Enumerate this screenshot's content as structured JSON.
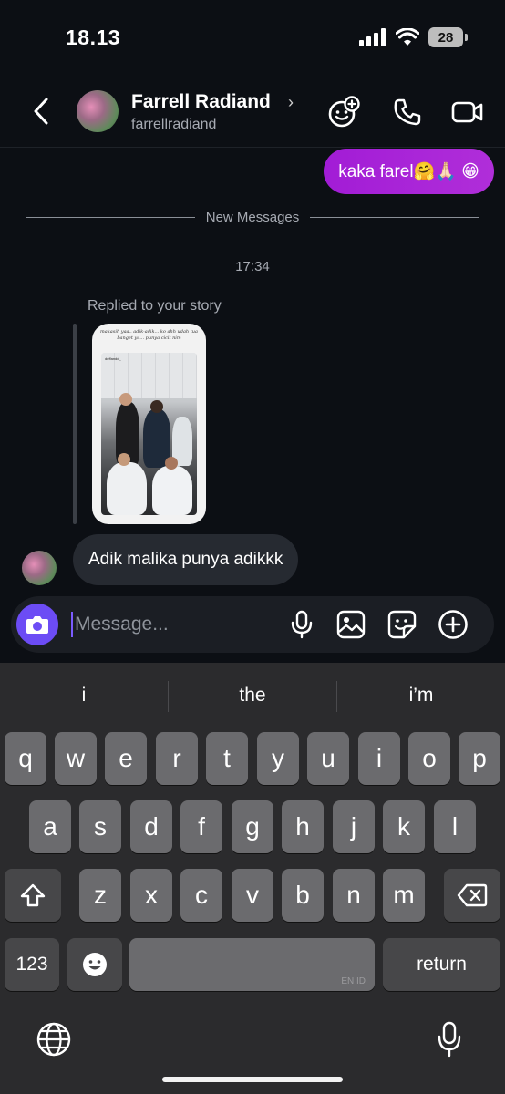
{
  "status_bar": {
    "time": "18.13",
    "battery": "28"
  },
  "header": {
    "contact_name": "Farrell Radiand",
    "chevron": "›",
    "handle": "farrellradiand",
    "icons": [
      "back-chevron-icon",
      "effects-add-icon",
      "phone-icon",
      "video-camera-icon"
    ]
  },
  "messages": {
    "outgoing_text": "kaka farel🤗🙏🏻 😁",
    "new_messages_label": "New Messages",
    "timestamp": "17:34",
    "reply_label": "Replied to your story",
    "story": {
      "caption": "makasih yaa.. adik-adik... ko ahh udah tua banget ya... punya cicit nim",
      "username": "deffandd_"
    },
    "incoming_text": "Adik malika punya adikkk"
  },
  "composer": {
    "placeholder": "Message...",
    "icons": [
      "camera-icon",
      "microphone-icon",
      "gallery-icon",
      "sticker-icon",
      "add-circle-icon"
    ]
  },
  "keyboard": {
    "suggestions": [
      "i",
      "the",
      "i’m"
    ],
    "row1": [
      "q",
      "w",
      "e",
      "r",
      "t",
      "y",
      "u",
      "i",
      "o",
      "p"
    ],
    "row2": [
      "a",
      "s",
      "d",
      "f",
      "g",
      "h",
      "j",
      "k",
      "l"
    ],
    "row3": [
      "z",
      "x",
      "c",
      "v",
      "b",
      "n",
      "m"
    ],
    "numbers_label": "123",
    "space_hint": "EN ID",
    "return_label": "return",
    "icons": [
      "shift-icon",
      "delete-icon",
      "emoji-icon",
      "globe-icon",
      "dictation-mic-icon"
    ],
    "colors": {
      "key": "#6b6b6e",
      "key_dark": "#474749",
      "background": "#2b2b2d"
    }
  },
  "colors": {
    "outgoing_bubble": "#a21cd6",
    "camera_button": "#6c4cf5",
    "background": "#0c0f14"
  }
}
